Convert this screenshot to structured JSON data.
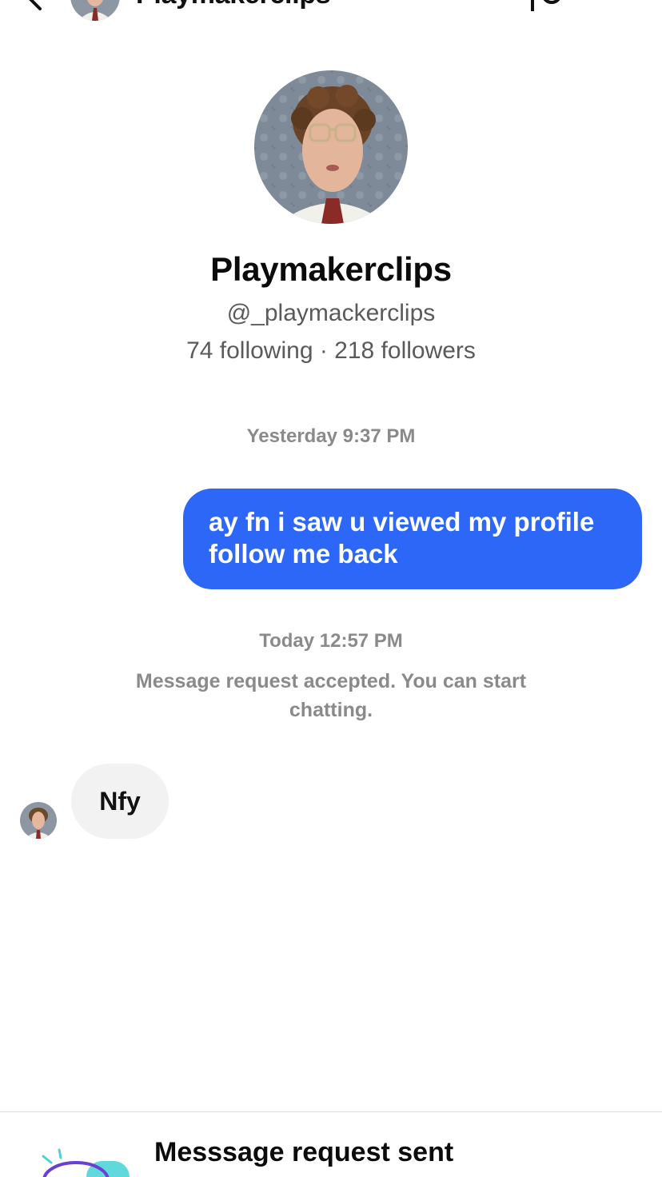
{
  "header": {
    "title": "Playmakerclips",
    "back_icon": "chevron-left-icon",
    "report_icon": "flag-icon"
  },
  "profile": {
    "display_name": "Playmakerclips",
    "handle": "@_playmackerclips",
    "stats": "74 following · 218 followers"
  },
  "conversation": {
    "timestamp_1": "Yesterday 9:37 PM",
    "outgoing_message": "ay fn i saw u viewed my profile follow me back",
    "timestamp_2": "Today 12:57 PM",
    "system_message": "Message request accepted. You can start chatting.",
    "incoming_message": "Nfy"
  },
  "footer": {
    "status": "Messsage request sent"
  },
  "colors": {
    "outgoing_bubble": "#2d67f7",
    "incoming_bubble": "#f2f2f2",
    "muted_text": "#8a8a8a"
  }
}
